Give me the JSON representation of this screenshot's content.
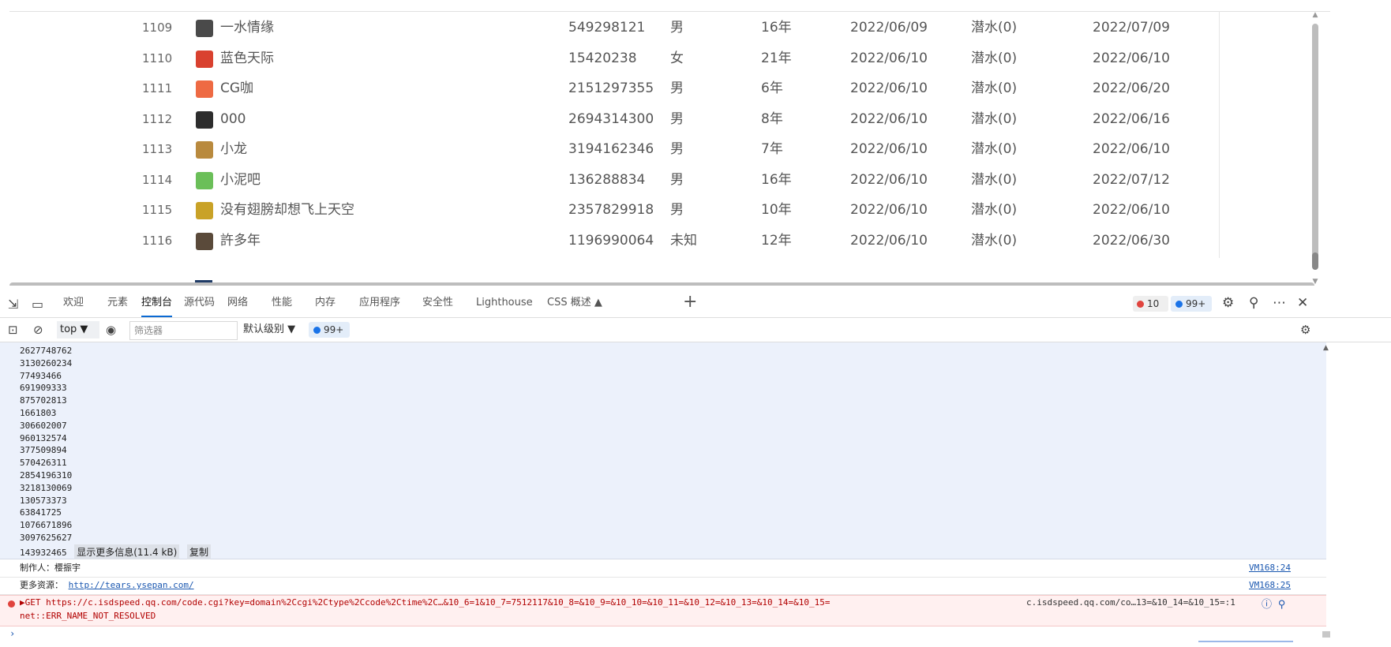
{
  "table": {
    "rows": [
      {
        "idx": "1109",
        "name": "一水情缘",
        "qq": "549298121",
        "sex": "男",
        "age": "16年",
        "join": "2022/06/09",
        "level": "潜水(0)",
        "last": "2022/07/09",
        "avatar": "#4a4a4a"
      },
      {
        "idx": "1110",
        "name": "蓝色天际",
        "qq": "15420238",
        "sex": "女",
        "age": "21年",
        "join": "2022/06/10",
        "level": "潜水(0)",
        "last": "2022/06/10",
        "avatar": "#d9412f"
      },
      {
        "idx": "1111",
        "name": "CG咖",
        "qq": "2151297355",
        "sex": "男",
        "age": "6年",
        "join": "2022/06/10",
        "level": "潜水(0)",
        "last": "2022/06/20",
        "avatar": "#ee6a43"
      },
      {
        "idx": "1112",
        "name": "000",
        "qq": "2694314300",
        "sex": "男",
        "age": "8年",
        "join": "2022/06/10",
        "level": "潜水(0)",
        "last": "2022/06/16",
        "avatar": "#2d2d2d"
      },
      {
        "idx": "1113",
        "name": "小龙",
        "qq": "3194162346",
        "sex": "男",
        "age": "7年",
        "join": "2022/06/10",
        "level": "潜水(0)",
        "last": "2022/06/10",
        "avatar": "#b98a3e"
      },
      {
        "idx": "1114",
        "name": "小泥吧",
        "qq": "136288834",
        "sex": "男",
        "age": "16年",
        "join": "2022/06/10",
        "level": "潜水(0)",
        "last": "2022/07/12",
        "avatar": "#6bbf59"
      },
      {
        "idx": "1115",
        "name": "没有翅膀却想飞上天空",
        "qq": "2357829918",
        "sex": "男",
        "age": "10年",
        "join": "2022/06/10",
        "level": "潜水(0)",
        "last": "2022/06/10",
        "avatar": "#c9a227"
      },
      {
        "idx": "1116",
        "name": "許多年",
        "qq": "1196990064",
        "sex": "未知",
        "age": "12年",
        "join": "2022/06/10",
        "level": "潜水(0)",
        "last": "2022/06/30",
        "avatar": "#5a4a3a"
      }
    ]
  },
  "devtools": {
    "tabs": [
      "欢迎",
      "元素",
      "控制台",
      "源代码",
      "网络",
      "性能",
      "内存",
      "应用程序",
      "安全性",
      "Lighthouse",
      "CSS 概述 ▲"
    ],
    "active_tab": "控制台",
    "error_count": "10",
    "message_count": "99+",
    "toolbar": {
      "context": "top ▼",
      "filter_placeholder": "筛选器",
      "levels": "默认级别 ▼",
      "badge": "99+"
    }
  },
  "console": {
    "numbers": [
      "2627748762",
      "3130260234",
      "77493466",
      "691909333",
      "875702813",
      "1661803",
      "306602007",
      "960132574",
      "377509894",
      "570426311",
      "2854196310",
      "3218130069",
      "130573373",
      "63841725",
      "1076671896",
      "3097625627"
    ],
    "last_number": "143932465",
    "show_more": "显示更多信息(11.4 kB)",
    "copy": "复制",
    "author_line": "制作人：樱振宇",
    "author_src": "VM168:24",
    "resource_label": "更多资源：",
    "resource_link": "http://tears.ysepan.com/",
    "resource_src": "VM168:25",
    "error_method": "▶GET",
    "error_url": "https://c.isdspeed.qq.com/code.cgi?key=domain%2Ccgi%2Ctype%2Ccode%2Ctime%2C…&10_6=1&10_7=7512117&10_8=&10_9=&10_10=&10_11=&10_12=&10_13=&10_14=&10_15=",
    "error_message": "net::ERR_NAME_NOT_RESOLVED",
    "error_src": "c.isdspeed.qq.com/co…13=&10_14=&10_15=:1",
    "prompt": "›"
  },
  "colors": {
    "accent": "#0b6ad3",
    "error": "#e0443e",
    "info": "#1a73e8"
  }
}
